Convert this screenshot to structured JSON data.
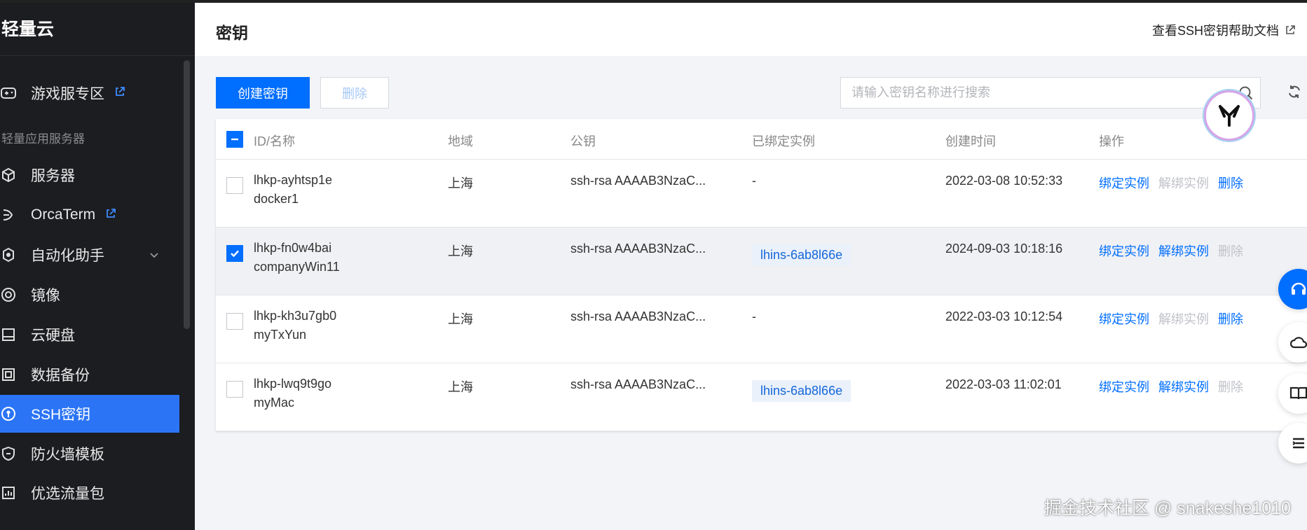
{
  "app": {
    "brand": "轻量云"
  },
  "sidebar": {
    "group_label": "轻量应用服务器",
    "items": [
      {
        "label": "游戏服专区",
        "icon": "gamepad-icon",
        "external": true
      },
      {
        "label": "服务器",
        "icon": "cube-icon"
      },
      {
        "label": "OrcaTerm",
        "icon": "terminal-icon",
        "external": true
      },
      {
        "label": "自动化助手",
        "icon": "automation-icon",
        "expandable": true
      },
      {
        "label": "镜像",
        "icon": "image-icon"
      },
      {
        "label": "云硬盘",
        "icon": "disk-icon"
      },
      {
        "label": "数据备份",
        "icon": "backup-icon"
      },
      {
        "label": "SSH密钥",
        "icon": "key-icon",
        "active": true
      },
      {
        "label": "防火墙模板",
        "icon": "shield-icon"
      },
      {
        "label": "优选流量包",
        "icon": "traffic-icon"
      }
    ]
  },
  "header": {
    "title": "密钥",
    "help_link": "查看SSH密钥帮助文档"
  },
  "toolbar": {
    "create_label": "创建密钥",
    "delete_label": "删除",
    "search_placeholder": "请输入密钥名称进行搜索"
  },
  "table": {
    "columns": [
      "ID/名称",
      "地域",
      "公钥",
      "已绑定实例",
      "创建时间",
      "操作"
    ],
    "rows": [
      {
        "id": "lhkp-ayhtsp1e",
        "name": "docker1",
        "region": "上海",
        "pubkey": "ssh-rsa AAAAB3NzaC...",
        "instance": "-",
        "created": "2022-03-08 10:52:33",
        "checked": false,
        "bind": "绑定实例",
        "unbind": "解绑实例",
        "delete": "删除",
        "unbind_enabled": false,
        "delete_enabled": true
      },
      {
        "id": "lhkp-fn0w4bai",
        "name": "companyWin11",
        "region": "上海",
        "pubkey": "ssh-rsa AAAAB3NzaC...",
        "instance": "lhins-6ab8l66e",
        "created": "2024-09-03 10:18:16",
        "checked": true,
        "bind": "绑定实例",
        "unbind": "解绑实例",
        "delete": "删除",
        "unbind_enabled": true,
        "delete_enabled": false
      },
      {
        "id": "lhkp-kh3u7gb0",
        "name": "myTxYun",
        "region": "上海",
        "pubkey": "ssh-rsa AAAAB3NzaC...",
        "instance": "-",
        "created": "2022-03-03 10:12:54",
        "checked": false,
        "bind": "绑定实例",
        "unbind": "解绑实例",
        "delete": "删除",
        "unbind_enabled": false,
        "delete_enabled": true
      },
      {
        "id": "lhkp-lwq9t9go",
        "name": "myMac",
        "region": "上海",
        "pubkey": "ssh-rsa AAAAB3NzaC...",
        "instance": "lhins-6ab8l66e",
        "created": "2022-03-03 11:02:01",
        "checked": false,
        "bind": "绑定实例",
        "unbind": "解绑实例",
        "delete": "删除",
        "unbind_enabled": true,
        "delete_enabled": false
      }
    ]
  },
  "watermark": "掘金技术社区 @ snakeshe1010",
  "colors": {
    "primary": "#006eff",
    "sidebar_bg": "#1c1d21",
    "active_item": "#2b74f6"
  }
}
